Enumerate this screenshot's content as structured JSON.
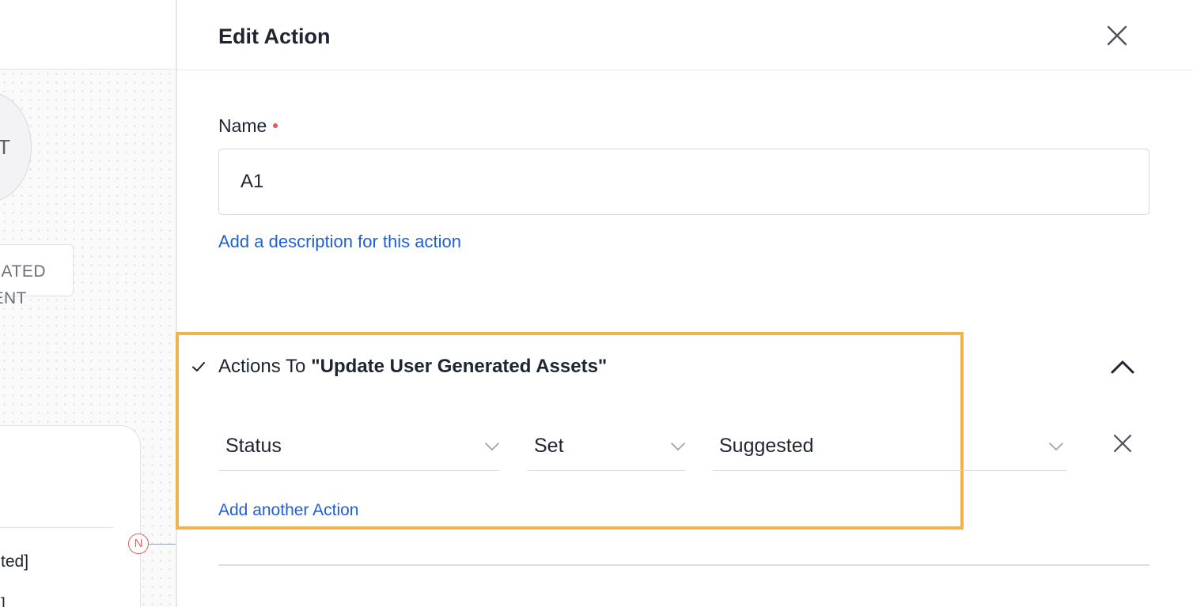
{
  "canvas": {
    "node_letter": "T",
    "node_tag_line1": "ATED",
    "node_tag_line2": "ENT",
    "card_line1": "ted]",
    "card_line2": "]",
    "badge": "N"
  },
  "panel": {
    "title": "Edit Action",
    "name_label": "Name",
    "name_value": "A1",
    "description_link": "Add a description for this action"
  },
  "actions": {
    "prefix": "Actions To",
    "target": "\"Update User Generated Assets\"",
    "row": {
      "field": "Status",
      "operator": "Set",
      "value": "Suggested"
    },
    "add_link": "Add another Action"
  },
  "colors": {
    "accent_link": "#1f5fd6",
    "highlight_border": "#f0b44c",
    "required": "#e45a5a"
  },
  "icons": [
    "close-icon",
    "check-icon",
    "chevron-up-icon",
    "chevron-down-icon",
    "remove-icon"
  ]
}
